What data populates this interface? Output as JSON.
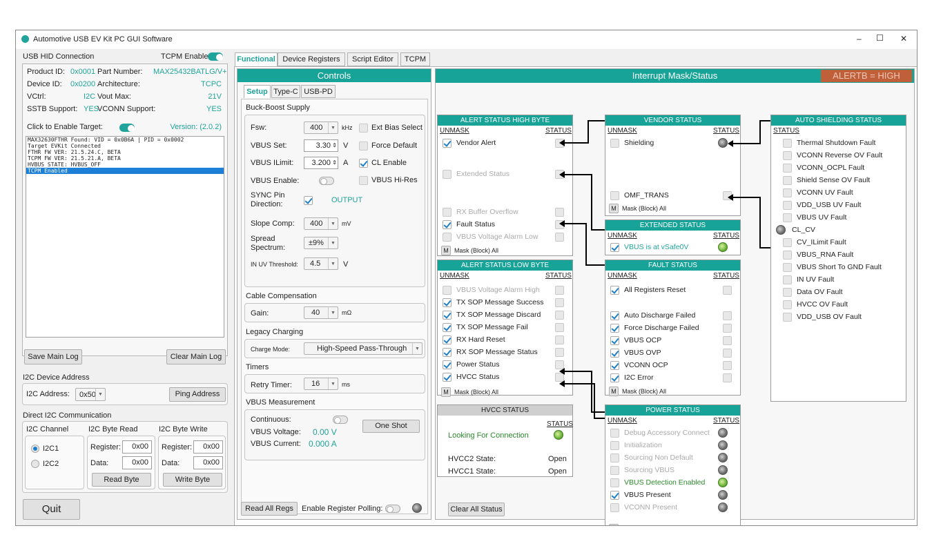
{
  "window": {
    "title": "Automotive USB EV Kit PC GUI Software",
    "min": "–",
    "max": "☐",
    "close": "✕"
  },
  "usb": {
    "header": "USB HID Connection",
    "tcpm_enable": "TCPM Enable:",
    "product_id_label": "Product ID:",
    "product_id": "0x0001",
    "part_number_label": "Part Number:",
    "part_number": "MAX25432BATLG/V+",
    "device_id_label": "Device ID:",
    "device_id": "0x0200",
    "architecture_label": "Architecture:",
    "architecture": "TCPC",
    "vctrl_label": "VCtrl:",
    "vctrl": "I2C",
    "vout_max_label": "Vout Max:",
    "vout_max": "21V",
    "sstb_label": "SSTB Support:",
    "sstb": "YES",
    "vconn_label": "VCONN Support:",
    "vconn": "YES",
    "click_enable": "Click to Enable Target:",
    "version": "Version: (2.0.2)"
  },
  "log": {
    "lines": [
      "MAX32630FTHR Found: VID = 0x0B6A | PID = 0x0002",
      "Target EVKit Connected",
      "FTHR FW VER: 21.5.24.C, BETA",
      "TCPM FW VER: 21.5.21.A, BETA",
      "HVBUS STATE: HVBUS_OFF",
      "TCPM Enabled"
    ],
    "save": "Save Main Log",
    "clear": "Clear Main Log"
  },
  "i2c": {
    "device_header": "I2C Device Address",
    "address_label": "I2C Address:",
    "address": "0x50",
    "ping": "Ping Address",
    "direct_header": "Direct I2C Communication",
    "channel": "I2C Channel",
    "byte_read": "I2C Byte Read",
    "byte_write": "I2C Byte Write",
    "ch1": "I2C1",
    "ch2": "I2C2",
    "register": "Register:",
    "data": "Data:",
    "r_reg": "0x00",
    "r_data": "0x00",
    "w_reg": "0x00",
    "w_data": "0x00",
    "read_btn": "Read Byte",
    "write_btn": "Write Byte",
    "quit": "Quit"
  },
  "tabs": [
    "Functional",
    "Device Registers",
    "Script Editor",
    "TCPM"
  ],
  "controls": {
    "header": "Controls",
    "subtabs": [
      "Setup",
      "Type-C",
      "USB-PD"
    ],
    "buck_boost": "Buck-Boost Supply",
    "fsw_label": "Fsw:",
    "fsw": "400",
    "fsw_unit": "kHz",
    "ext_bias": "Ext Bias Select",
    "vbus_set_label": "VBUS Set:",
    "vbus_set": "3.30",
    "vbus_set_unit": "V",
    "force_default": "Force Default",
    "vbus_ilimit_label": "VBUS ILimit:",
    "vbus_ilimit": "3.200",
    "ilimit_unit": "A",
    "cl_enable": "CL Enable",
    "vbus_enable": "VBUS Enable:",
    "vbus_hires": "VBUS Hi-Res",
    "sync_pin": "SYNC Pin",
    "direction": "Direction:",
    "output": "OUTPUT",
    "slope_label": "Slope Comp:",
    "slope": "400",
    "slope_unit": "mV",
    "spread1": "Spread",
    "spread2": "Spectrum:",
    "spread": "±9%",
    "uv_label": "IN UV Threshold:",
    "uv": "4.5",
    "uv_unit": "V",
    "cable_comp": "Cable Compensation",
    "gain_label": "Gain:",
    "gain": "40",
    "gain_unit": "mΩ",
    "legacy": "Legacy Charging",
    "charge_mode_label": "Charge Mode:",
    "charge_mode": "High-Speed Pass-Through",
    "timers": "Timers",
    "retry_label": "Retry Timer:",
    "retry": "16",
    "retry_unit": "ms",
    "vbus_meas": "VBUS Measurement",
    "continuous": "Continuous:",
    "one_shot": "One Shot",
    "vbus_voltage_label": "VBUS Voltage:",
    "vbus_voltage": "0.00 V",
    "vbus_current_label": "VBUS Current:",
    "vbus_current": "0.000 A",
    "read_all": "Read All Regs",
    "polling": "Enable Register Polling:"
  },
  "interrupt": {
    "header": "Interrupt Mask/Status",
    "alertb": "ALERTB = HIGH",
    "unmask": "UNMASK",
    "status": "STATUS",
    "mask_all": "Mask (Block) All",
    "m": "M",
    "clear_all": "Clear All Status",
    "alert_high": {
      "title": "ALERT STATUS HIGH BYTE",
      "items": [
        "Vendor Alert",
        "Extended Status",
        "RX Buffer Overflow",
        "Fault Status",
        "VBUS Voltage Alarm Low"
      ]
    },
    "alert_low": {
      "title": "ALERT STATUS LOW BYTE",
      "items": [
        "VBUS Voltage Alarm High",
        "TX SOP Message Success",
        "TX SOP Message Discard",
        "TX SOP Message Fail",
        "RX Hard Reset",
        "RX SOP Message Status",
        "Power Status",
        "HVCC Status"
      ]
    },
    "hvcc": {
      "title": "HVCC STATUS",
      "looking": "Looking For Connection",
      "hvcc2_label": "HVCC2 State:",
      "hvcc2": "Open",
      "hvcc1_label": "HVCC1 State:",
      "hvcc1": "Open"
    },
    "vendor": {
      "title": "VENDOR STATUS",
      "items": [
        "Shielding",
        "OMF_TRANS"
      ]
    },
    "extended": {
      "title": "EXTENDED STATUS",
      "items": [
        "VBUS is at vSafe0V"
      ]
    },
    "fault": {
      "title": "FAULT STATUS",
      "items": [
        "All Registers Reset",
        "Auto Discharge Failed",
        "Force Discharge Failed",
        "VBUS OCP",
        "VBUS OVP",
        "VCONN OCP",
        "I2C Error"
      ]
    },
    "power": {
      "title": "POWER STATUS",
      "items": [
        "Debug Accessory Connect",
        "Initialization",
        "Sourcing Non Default",
        "Sourcing VBUS",
        "VBUS Detection Enabled",
        "VBUS Present",
        "VCONN Present"
      ]
    },
    "auto": {
      "title": "AUTO SHIELDING STATUS",
      "items": [
        "Thermal Shutdown Fault",
        "VCONN Reverse OV Fault",
        "VCONN_OCPL Fault",
        "Shield Sense OV Fault",
        "VCONN UV Fault",
        "VDD_USB UV Fault",
        "VBUS UV Fault",
        "CL_CV",
        "CV_ILimit Fault",
        "VBUS_RNA Fault",
        "VBUS Short To GND Fault",
        "IN UV Fault",
        "Data OV Fault",
        "HVCC OV Fault",
        "VDD_USB OV Fault"
      ]
    }
  },
  "colors": {
    "teal": "#17a398",
    "alert": "#c0603a"
  }
}
